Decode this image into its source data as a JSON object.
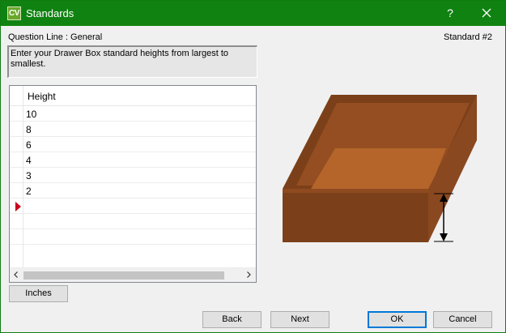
{
  "window": {
    "title": "Standards",
    "app_icon_text": "CV",
    "help_glyph": "?"
  },
  "header": {
    "question_line": "Question Line : General",
    "standard_label": "Standard #2"
  },
  "instruction": "Enter your Drawer Box standard heights from largest to smallest.",
  "grid": {
    "column": "Height",
    "rows": [
      "10",
      "8",
      "6",
      "4",
      "3",
      "2",
      "",
      "",
      "",
      ""
    ],
    "new_row_index": 6
  },
  "units_button": "Inches",
  "buttons": {
    "back": "Back",
    "next": "Next",
    "ok": "OK",
    "cancel": "Cancel"
  },
  "colors": {
    "titlebar": "#108211",
    "box_dark": "#7b4019",
    "box_mid": "#944e21",
    "box_inner": "#b5652a",
    "new_row_marker": "#c8001e"
  },
  "icons": {
    "app": "cv-logo-icon",
    "close": "close-icon",
    "new_row": "row-pointer-icon",
    "scroll_left": "chevron-left-icon",
    "scroll_right": "chevron-right-icon",
    "height_arrow": "height-arrow-icon"
  }
}
